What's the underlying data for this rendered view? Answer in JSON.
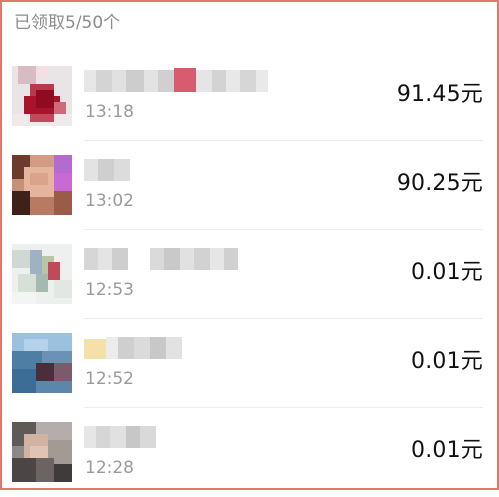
{
  "header": {
    "claimed_status": "已领取5/50个"
  },
  "records": [
    {
      "time": "13:18",
      "amount": "91.45元",
      "name_redacted": true,
      "avatar_redacted": true
    },
    {
      "time": "13:02",
      "amount": "90.25元",
      "name_redacted": true,
      "avatar_redacted": true
    },
    {
      "time": "12:53",
      "amount": "0.01元",
      "name_redacted": true,
      "avatar_redacted": true
    },
    {
      "time": "12:52",
      "amount": "0.01元",
      "name_redacted": true,
      "avatar_redacted": true
    },
    {
      "time": "12:28",
      "amount": "0.01元",
      "name_redacted": true,
      "avatar_redacted": true
    }
  ],
  "colors": {
    "frame_border": "#e4776b",
    "header_text": "#8c8c8c",
    "time_text": "#9a9a9a",
    "amount_text": "#111111"
  }
}
